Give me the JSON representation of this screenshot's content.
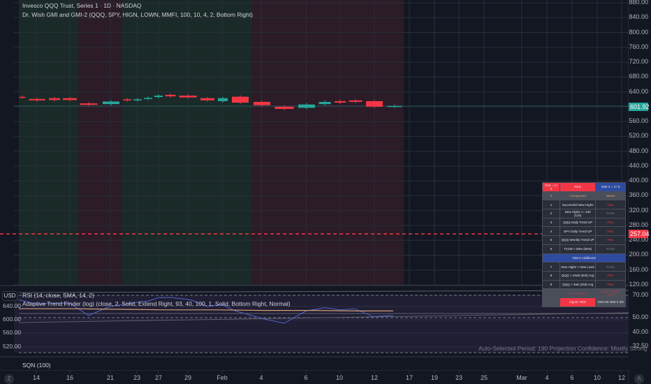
{
  "header": {
    "symbol_title": "Invesco QQQ Trust, Series 1 · 1D · NASDAQ",
    "indicator": "Dr. Wish GMI and GMI-2 (QQQ, SPY, HIGN, LOWN, MMFI, 100, 10, 4, 2, Bottom Right)"
  },
  "price_axis": {
    "labels": [
      "880.00",
      "840.00",
      "800.00",
      "760.00",
      "720.00",
      "680.00",
      "640.00",
      "560.00",
      "520.00",
      "480.00",
      "440.00",
      "400.00",
      "360.00",
      "320.00",
      "280.00",
      "240.00",
      "200.00",
      "160.00",
      "120.00"
    ],
    "last_price": "601.92",
    "line_price": "257.04",
    "range": [
      120,
      880
    ]
  },
  "colors": {
    "up": "#26a69a",
    "down": "#f23645",
    "bg": "#131722",
    "green_zone": "#1a2a28",
    "red_zone": "#2b1c27"
  },
  "candles": [
    [
      626.5,
      625.5
    ],
    [
      621,
      617
    ],
    [
      623,
      618
    ],
    [
      623,
      618
    ],
    [
      609,
      605
    ],
    [
      607,
      614
    ],
    [
      620,
      617
    ],
    [
      617,
      620
    ],
    [
      621,
      624
    ],
    [
      626,
      630
    ],
    [
      632,
      628
    ],
    [
      630,
      625
    ],
    [
      623,
      617
    ],
    [
      615,
      623
    ],
    [
      627,
      611
    ],
    [
      613,
      604
    ],
    [
      600,
      594
    ],
    [
      597,
      606
    ],
    [
      607,
      613
    ],
    [
      615,
      611
    ],
    [
      617,
      613
    ],
    [
      615,
      600
    ],
    [
      601,
      602
    ]
  ],
  "gmi_table": {
    "header": [
      "GMI = 2 / 6",
      "RED",
      "GMI-2 = 3 / 9"
    ],
    "columns": [
      "#",
      "Component",
      "Status"
    ],
    "rows": [
      [
        "1",
        "Successful New Highs",
        "FAIL"
      ],
      [
        "2",
        "New Highs >= 100 (132)",
        "PASS"
      ],
      [
        "3",
        "QQQ Daily Trend UP",
        "FAIL"
      ],
      [
        "4",
        "SPY Daily Trend UP",
        "FAIL"
      ],
      [
        "5",
        "QQQ Weekly Trend UP",
        "FAIL"
      ],
      [
        "6",
        "T2108 > 50% (55%)",
        "PASS"
      ]
    ],
    "section": "GMI-2 Additional",
    "rows2": [
      [
        "7",
        "New Highs > New Lows",
        "PASS"
      ],
      [
        "8",
        "QQQ > 10wk (50d) Avg",
        "FAIL"
      ],
      [
        "9",
        "QQQ > 4wk (20d) Avg",
        "FAIL"
      ]
    ],
    "footer1": [
      "T2108: 15%",
      "QQQ < 10wk: -3.7%"
    ],
    "footer2": [
      "Signal: RED",
      "GMI 2/6  GMI-2 3/9"
    ]
  },
  "lower": {
    "currency": "USD",
    "rsi": "RSI (14, close, SMA, 14, 2)",
    "atf": "Adaptive Trend Finder (log) (close, 2, Solid, Extend Right, 93, 40, 100, 1, Solid, Bottom Right, Normal)",
    "left_labels": [
      "640.00",
      "600.00",
      "560.00",
      "520.00"
    ],
    "right_labels": [
      "70.00",
      "50.00",
      "40.00",
      "32.50"
    ],
    "note": "Auto-Selected Period: 190  Projection Confidence: Mostly Strong",
    "rsi_values": [
      66,
      62,
      63,
      63,
      52,
      60,
      63,
      65,
      68,
      68,
      66,
      60,
      62,
      56,
      49,
      45,
      56,
      59,
      57,
      58,
      51,
      52
    ],
    "rsi_ma": [
      58,
      58,
      57.5,
      57,
      57,
      56.5,
      56.5,
      56,
      56
    ]
  },
  "sqn": {
    "label": "SQN (100)"
  },
  "time_axis": [
    "14",
    "16",
    "21",
    "23",
    "27",
    "29",
    "Feb",
    "4",
    "6",
    "10",
    "12",
    "17",
    "19",
    "23",
    "25",
    "Mar",
    "4",
    "6",
    "10",
    "12"
  ],
  "buttons": {
    "auto": "A",
    "tz": "Z"
  }
}
